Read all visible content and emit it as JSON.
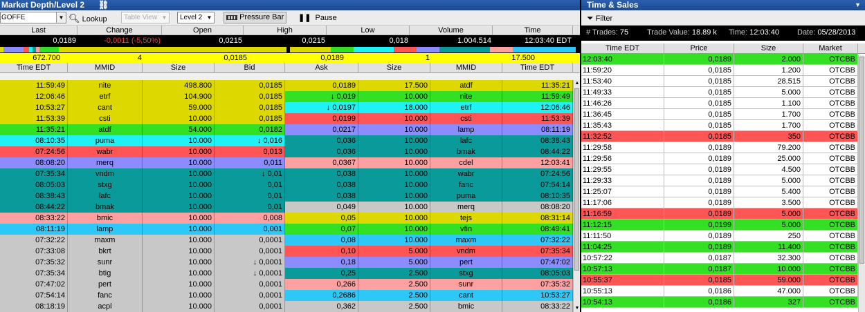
{
  "level2": {
    "title": "Market Depth/Level 2",
    "symbol": "GOFFE",
    "lookup_label": "Lookup",
    "table_view_label": "Table View",
    "level_select": "Level 2",
    "pressure_bar_label": "Pressure Bar",
    "pause_label": "Pause",
    "quote_headers": [
      "Last",
      "Change",
      "Open",
      "High",
      "Low",
      "Volume",
      "Time"
    ],
    "quote_values": [
      "0,0189",
      "-0,0011 (-5,50%)",
      "0,0215",
      "0,0215",
      "0,018",
      "1.004.514",
      "12:03:40 EDT"
    ],
    "change_color": "#ff3b3b",
    "summary": [
      "672.700",
      "4",
      "0,0185",
      "0,0189",
      "1",
      "17.500"
    ],
    "bid_headers": [
      "Time EDT",
      "MMID",
      "Size",
      "Bid"
    ],
    "ask_headers": [
      "Ask",
      "Size",
      "MMID",
      "Time EDT"
    ],
    "rows": [
      {
        "bid": {
          "time": "11:59:49",
          "mmid": "nite",
          "size": "498.800",
          "price": "0,0185",
          "color": "#dcd800"
        },
        "ask": {
          "time": "11:35:21",
          "mmid": "atdf",
          "size": "17.500",
          "price": "0,0189",
          "color": "#dcd800"
        }
      },
      {
        "bid": {
          "time": "12:06:46",
          "mmid": "etrf",
          "size": "104.900",
          "price": "0,0185",
          "color": "#dcd800"
        },
        "ask": {
          "time": "11:59:49",
          "mmid": "nite",
          "size": "10.000",
          "price": "↓ 0,019",
          "color": "#33e024"
        }
      },
      {
        "bid": {
          "time": "10:53:27",
          "mmid": "cant",
          "size": "59.000",
          "price": "0,0185",
          "color": "#dcd800"
        },
        "ask": {
          "time": "12:06:46",
          "mmid": "etrf",
          "size": "18.000",
          "price": "↓ 0,0197",
          "color": "#1ef2f2"
        }
      },
      {
        "bid": {
          "time": "11:53:39",
          "mmid": "csti",
          "size": "10.000",
          "price": "0,0185",
          "color": "#dcd800"
        },
        "ask": {
          "time": "11:53:39",
          "mmid": "csti",
          "size": "10.000",
          "price": "0,0199",
          "color": "#ff5555"
        }
      },
      {
        "bid": {
          "time": "11:35:21",
          "mmid": "atdf",
          "size": "54.000",
          "price": "0,0182",
          "color": "#33e024"
        },
        "ask": {
          "time": "08:11:19",
          "mmid": "lamp",
          "size": "10.000",
          "price": "0,0217",
          "color": "#8c8cff"
        }
      },
      {
        "bid": {
          "time": "08:10:35",
          "mmid": "puma",
          "size": "10.000",
          "price": "↓ 0,016",
          "color": "#1ef2f2"
        },
        "ask": {
          "time": "08:38:43",
          "mmid": "lafc",
          "size": "10.000",
          "price": "0,036",
          "color": "#0a9a9a"
        }
      },
      {
        "bid": {
          "time": "07:24:56",
          "mmid": "wabr",
          "size": "10.000",
          "price": "0,013",
          "color": "#ff5555"
        },
        "ask": {
          "time": "08:44:22",
          "mmid": "bmak",
          "size": "10.000",
          "price": "0,036",
          "color": "#0a9a9a"
        }
      },
      {
        "bid": {
          "time": "08:08:20",
          "mmid": "merq",
          "size": "10.000",
          "price": "0,011",
          "color": "#8c8cff"
        },
        "ask": {
          "time": "12:03:41",
          "mmid": "cdel",
          "size": "10.000",
          "price": "0,0367",
          "color": "#ffa0a0"
        }
      },
      {
        "bid": {
          "time": "07:35:34",
          "mmid": "vndm",
          "size": "10.000",
          "price": "↓ 0,01",
          "color": "#0a9a9a"
        },
        "ask": {
          "time": "07:24:56",
          "mmid": "wabr",
          "size": "10.000",
          "price": "0,038",
          "color": "#0a9a9a"
        }
      },
      {
        "bid": {
          "time": "08:05:03",
          "mmid": "stxg",
          "size": "10.000",
          "price": "0,01",
          "color": "#0a9a9a"
        },
        "ask": {
          "time": "07:54:14",
          "mmid": "fanc",
          "size": "10.000",
          "price": "0,038",
          "color": "#0a9a9a"
        }
      },
      {
        "bid": {
          "time": "08:38:43",
          "mmid": "lafc",
          "size": "10.000",
          "price": "0,01",
          "color": "#0a9a9a"
        },
        "ask": {
          "time": "08:10:35",
          "mmid": "puma",
          "size": "10.000",
          "price": "0,038",
          "color": "#0a9a9a"
        }
      },
      {
        "bid": {
          "time": "08:44:22",
          "mmid": "bmak",
          "size": "10.000",
          "price": "0,01",
          "color": "#0a9a9a"
        },
        "ask": {
          "time": "08:08:20",
          "mmid": "merq",
          "size": "10.000",
          "price": "0,049",
          "color": "#c8c8c8"
        }
      },
      {
        "bid": {
          "time": "08:33:22",
          "mmid": "bmic",
          "size": "10.000",
          "price": "0,008",
          "color": "#ffa0a0"
        },
        "ask": {
          "time": "08:31:14",
          "mmid": "tejs",
          "size": "10.000",
          "price": "0,05",
          "color": "#dcd800"
        }
      },
      {
        "bid": {
          "time": "08:11:19",
          "mmid": "lamp",
          "size": "10.000",
          "price": "0,001",
          "color": "#2ec8f8"
        },
        "ask": {
          "time": "08:49:41",
          "mmid": "vfin",
          "size": "10.000",
          "price": "0,07",
          "color": "#33e024"
        }
      },
      {
        "bid": {
          "time": "07:32:22",
          "mmid": "maxm",
          "size": "10.000",
          "price": "0,0001",
          "color": "#c8c8c8"
        },
        "ask": {
          "time": "07:32:22",
          "mmid": "maxm",
          "size": "10.000",
          "price": "0,08",
          "color": "#2ec8f8"
        }
      },
      {
        "bid": {
          "time": "07:33:08",
          "mmid": "bkrt",
          "size": "10.000",
          "price": "0,0001",
          "color": "#c8c8c8"
        },
        "ask": {
          "time": "07:35:34",
          "mmid": "vndm",
          "size": "5.000",
          "price": "0,10",
          "color": "#ff5555"
        }
      },
      {
        "bid": {
          "time": "07:35:32",
          "mmid": "sunr",
          "size": "10.000",
          "price": "↓ 0,0001",
          "color": "#c8c8c8"
        },
        "ask": {
          "time": "07:47:02",
          "mmid": "pert",
          "size": "5.000",
          "price": "0,18",
          "color": "#8c8cff"
        }
      },
      {
        "bid": {
          "time": "07:35:34",
          "mmid": "btig",
          "size": "10.000",
          "price": "↓ 0,0001",
          "color": "#c8c8c8"
        },
        "ask": {
          "time": "08:05:03",
          "mmid": "stxg",
          "size": "2.500",
          "price": "0,25",
          "color": "#0a9a9a"
        }
      },
      {
        "bid": {
          "time": "07:47:02",
          "mmid": "pert",
          "size": "10.000",
          "price": "0,0001",
          "color": "#c8c8c8"
        },
        "ask": {
          "time": "07:35:32",
          "mmid": "sunr",
          "size": "2.500",
          "price": "0,266",
          "color": "#ffa0a0"
        }
      },
      {
        "bid": {
          "time": "07:54:14",
          "mmid": "fanc",
          "size": "10.000",
          "price": "0,0001",
          "color": "#c8c8c8"
        },
        "ask": {
          "time": "10:53:27",
          "mmid": "cant",
          "size": "2.500",
          "price": "0,2686",
          "color": "#2ec8f8"
        }
      },
      {
        "bid": {
          "time": "08:18:19",
          "mmid": "acpl",
          "size": "10.000",
          "price": "0,0001",
          "color": "#c8c8c8"
        },
        "ask": {
          "time": "08:33:22",
          "mmid": "bmic",
          "size": "2.500",
          "price": "0,362",
          "color": "#c8c8c8"
        }
      }
    ],
    "pressure_segments": [
      {
        "color": "#dcd800",
        "frac": 0.006
      },
      {
        "color": "#8c8cff",
        "frac": 0.035
      },
      {
        "color": "#ff5555",
        "frac": 0.01
      },
      {
        "color": "#1ef2f2",
        "frac": 0.006
      },
      {
        "color": "#0a9a9a",
        "frac": 0.006
      },
      {
        "color": "#ffa0a0",
        "frac": 0.006
      },
      {
        "color": "#33e024",
        "frac": 0.034
      },
      {
        "color": "#dcd800",
        "frac": 0.397
      },
      {
        "color": "#000000",
        "frac": 0.006
      },
      {
        "color": "#dcd800",
        "frac": 0.071
      },
      {
        "color": "#33e024",
        "frac": 0.04
      },
      {
        "color": "#1ef2f2",
        "frac": 0.07
      },
      {
        "color": "#ff5555",
        "frac": 0.04
      },
      {
        "color": "#8c8cff",
        "frac": 0.04
      },
      {
        "color": "#0a9a9a",
        "frac": 0.088
      },
      {
        "color": "#ffa0a0",
        "frac": 0.04
      },
      {
        "color": "#2ec8f8",
        "frac": 0.11
      }
    ]
  },
  "ts": {
    "title": "Time & Sales",
    "filter_label": "Filter",
    "trades_label": "# Trades:",
    "trades_value": "75",
    "trade_value_label": "Trade Value:",
    "trade_value": "18.89 k",
    "time_label": "Time:",
    "time_value": "12:03:40",
    "date_label": "Date:",
    "date_value": "05/28/2013",
    "headers": [
      "Time EDT",
      "Price",
      "Size",
      "Market"
    ],
    "rows": [
      {
        "time": "12:03:40",
        "price": "0,0189",
        "size": "2.000",
        "market": "OTCBB",
        "color": "#33e024"
      },
      {
        "time": "11:59:20",
        "price": "0,0185",
        "size": "1.200",
        "market": "OTCBB",
        "color": "#ffffff"
      },
      {
        "time": "11:53:40",
        "price": "0,0185",
        "size": "28.515",
        "market": "OTCBB",
        "color": "#ffffff"
      },
      {
        "time": "11:49:33",
        "price": "0,0185",
        "size": "5.000",
        "market": "OTCBB",
        "color": "#ffffff"
      },
      {
        "time": "11:46:26",
        "price": "0,0185",
        "size": "1.100",
        "market": "OTCBB",
        "color": "#ffffff"
      },
      {
        "time": "11:36:45",
        "price": "0,0185",
        "size": "1.700",
        "market": "OTCBB",
        "color": "#ffffff"
      },
      {
        "time": "11:35:43",
        "price": "0,0185",
        "size": "1.700",
        "market": "OTCBB",
        "color": "#ffffff"
      },
      {
        "time": "11:32:52",
        "price": "0,0185",
        "size": "350",
        "market": "OTCBB",
        "color": "#ff5555"
      },
      {
        "time": "11:29:58",
        "price": "0,0189",
        "size": "79.200",
        "market": "OTCBB",
        "color": "#ffffff"
      },
      {
        "time": "11:29:56",
        "price": "0,0189",
        "size": "25.000",
        "market": "OTCBB",
        "color": "#ffffff"
      },
      {
        "time": "11:29:55",
        "price": "0,0189",
        "size": "4.500",
        "market": "OTCBB",
        "color": "#ffffff"
      },
      {
        "time": "11:29:33",
        "price": "0,0189",
        "size": "5.000",
        "market": "OTCBB",
        "color": "#ffffff"
      },
      {
        "time": "11:25:07",
        "price": "0,0189",
        "size": "5.400",
        "market": "OTCBB",
        "color": "#ffffff"
      },
      {
        "time": "11:17:06",
        "price": "0,0189",
        "size": "3.500",
        "market": "OTCBB",
        "color": "#ffffff"
      },
      {
        "time": "11:16:59",
        "price": "0,0189",
        "size": "5.000",
        "market": "OTCBB",
        "color": "#ff5555"
      },
      {
        "time": "11:12:15",
        "price": "0,0199",
        "size": "5.000",
        "market": "OTCBB",
        "color": "#33e024"
      },
      {
        "time": "11:11:50",
        "price": "0,0189",
        "size": "250",
        "market": "OTCBB",
        "color": "#ffffff"
      },
      {
        "time": "11:04:25",
        "price": "0,0189",
        "size": "11.400",
        "market": "OTCBB",
        "color": "#33e024"
      },
      {
        "time": "10:57:22",
        "price": "0,0187",
        "size": "32.300",
        "market": "OTCBB",
        "color": "#ffffff"
      },
      {
        "time": "10:57:13",
        "price": "0,0187",
        "size": "10.000",
        "market": "OTCBB",
        "color": "#33e024"
      },
      {
        "time": "10:55:37",
        "price": "0,0185",
        "size": "59.000",
        "market": "OTCBB",
        "color": "#ff5555"
      },
      {
        "time": "10:55:13",
        "price": "0,0186",
        "size": "47.000",
        "market": "OTCBB",
        "color": "#ffffff"
      },
      {
        "time": "10:54:13",
        "price": "0,0186",
        "size": "327",
        "market": "OTCBB",
        "color": "#33e024"
      }
    ]
  }
}
